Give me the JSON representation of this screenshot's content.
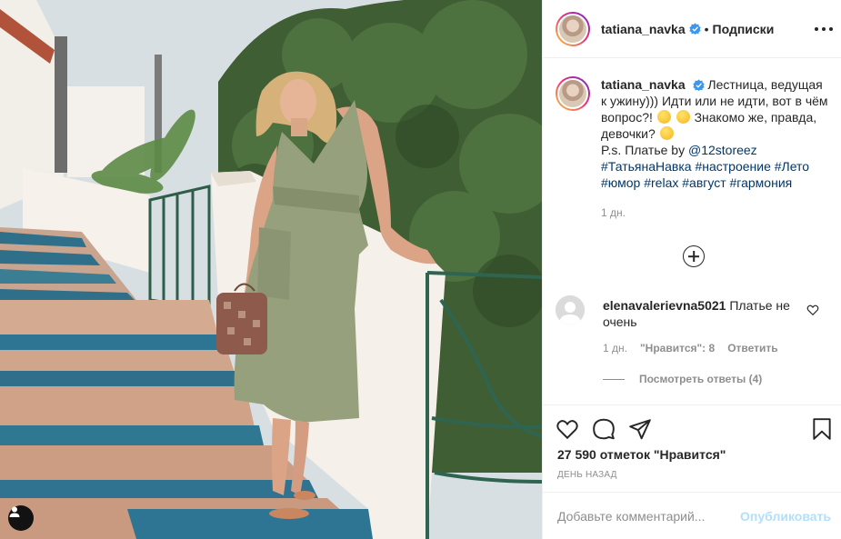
{
  "post": {
    "username": "tatiana_navka",
    "verified": true,
    "follow_separator": "•",
    "follow_label": "Подписки",
    "photo_description_icon": "user-tag-icon"
  },
  "caption": {
    "username": "tatiana_navka",
    "line1": "Лестница, ведущая к ужину))) Идти или не идти, вот в чём вопрос?! ",
    "line2": " Знакомо же, правда, девочки? ",
    "ps_prefix": "P.s. Платье by ",
    "mention": "@12storeez",
    "hashtags": [
      "#ТатьянаНавка",
      "#настроение",
      "#Лето",
      "#юмор",
      "#relax",
      "#август",
      "#гармония"
    ],
    "time": "1 дн."
  },
  "comments": [
    {
      "username": "elenavalerievna5021",
      "text": "Платье не очень",
      "time": "1 дн.",
      "likes": "\"Нравится\": 8",
      "reply_label": "Ответить",
      "view_replies": "Посмотреть ответы (4)"
    }
  ],
  "actions": {
    "likes_count": "27 590 отметок \"Нравится\"",
    "date": "ДЕНЬ НАЗАД"
  },
  "add_comment": {
    "placeholder": "Добавьте комментарий...",
    "publish_label": "Опубликовать"
  },
  "colors": {
    "link": "#00376b",
    "muted": "#8e8e8e",
    "verified": "#3897f0",
    "publish_disabled": "#b2dffc"
  }
}
